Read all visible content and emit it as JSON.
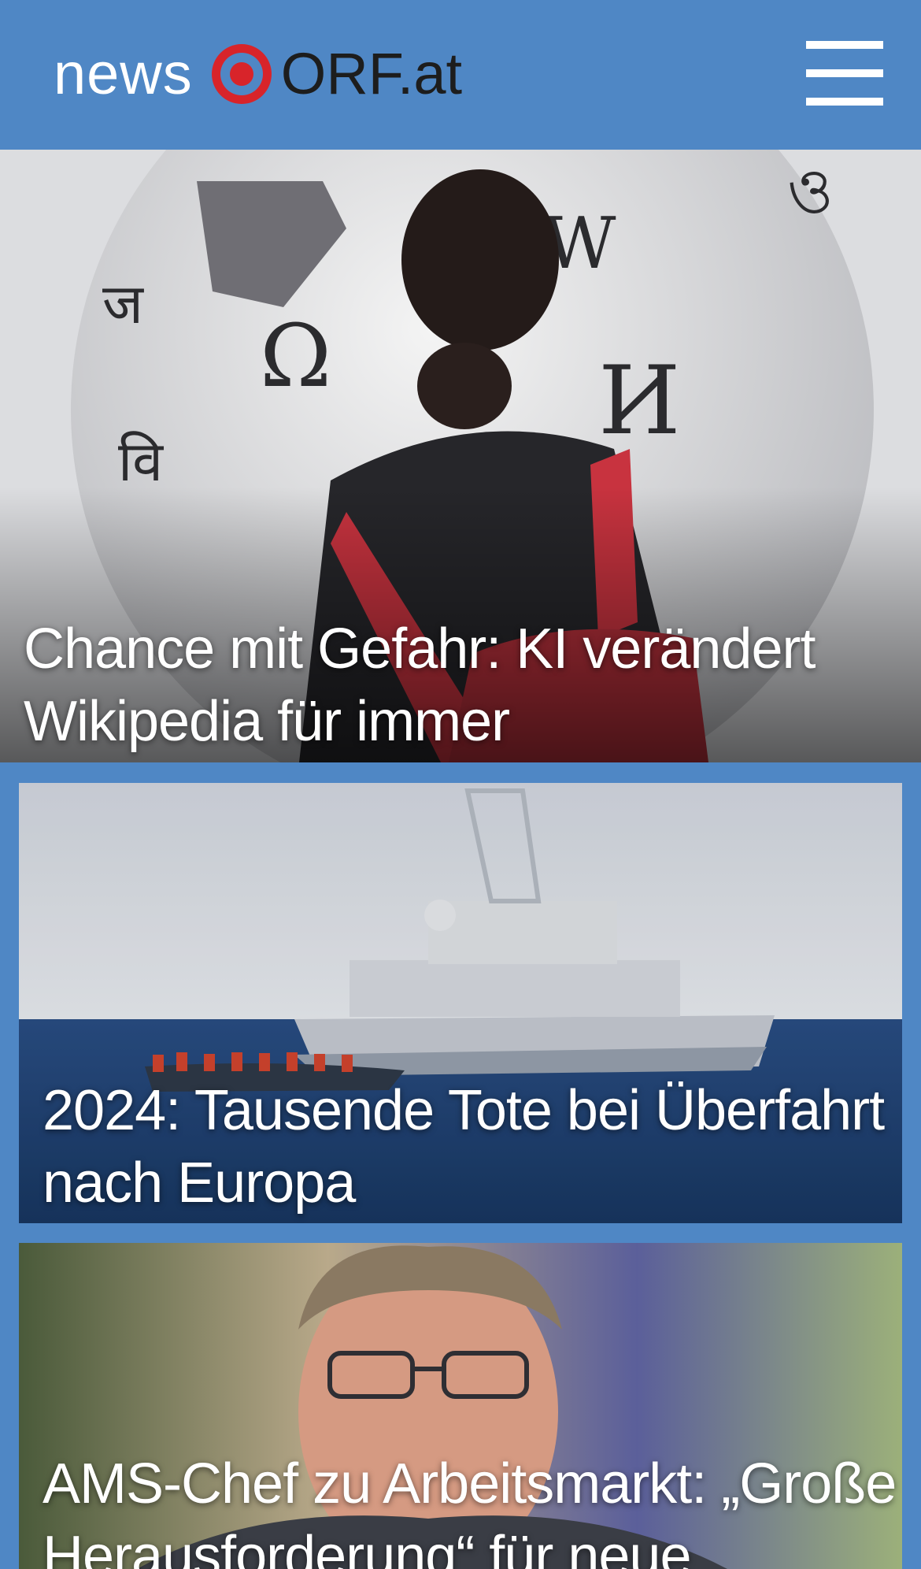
{
  "header": {
    "logo_news": "news",
    "logo_orf": "ORF.at",
    "menu_icon": "hamburger-menu-icon",
    "background": "#4f87c5"
  },
  "articles": [
    {
      "headline": "Chance mit Gefahr: KI verändert Wikipedia für immer"
    },
    {
      "headline": "2024: Tausende Tote bei Überfahrt nach Europa"
    },
    {
      "headline": "AMS-Chef zu Arbeitsmarkt: „Große Herausforderung“ für neue"
    }
  ],
  "colors": {
    "accent": "#4f87c5",
    "logo_red": "#d8242a"
  }
}
